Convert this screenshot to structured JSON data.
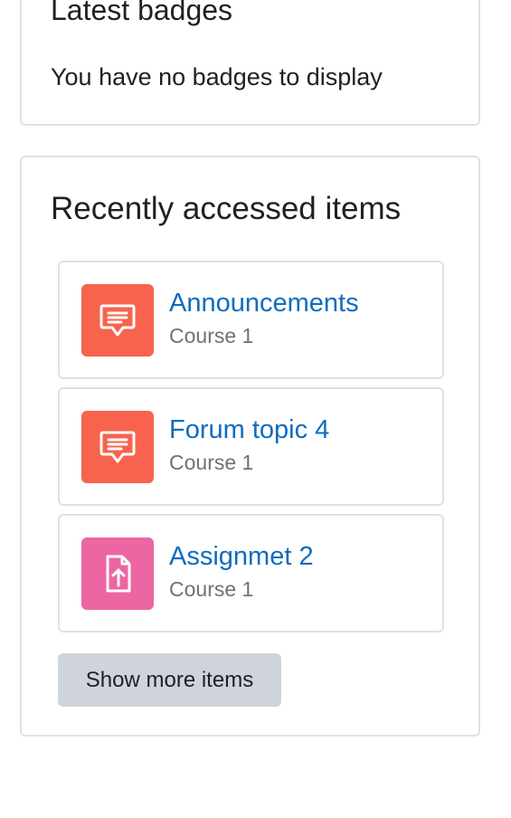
{
  "badges_block": {
    "title": "Latest badges",
    "empty_message": "You have no badges to display"
  },
  "recent_block": {
    "title": "Recently accessed items",
    "items": [
      {
        "name": "Announcements",
        "course": "Course 1",
        "icon": "forum-icon",
        "icon_color": "#f7634d"
      },
      {
        "name": "Forum topic 4",
        "course": "Course 1",
        "icon": "forum-icon",
        "icon_color": "#f7634d"
      },
      {
        "name": "Assignmet 2",
        "course": "Course 1",
        "icon": "assignment-icon",
        "icon_color": "#eb66a2"
      }
    ],
    "show_more_label": "Show more items"
  },
  "colors": {
    "link": "#0f6cbf",
    "muted_text": "#6a737b",
    "border": "#dee2e6",
    "button_bg": "#ced4da"
  }
}
